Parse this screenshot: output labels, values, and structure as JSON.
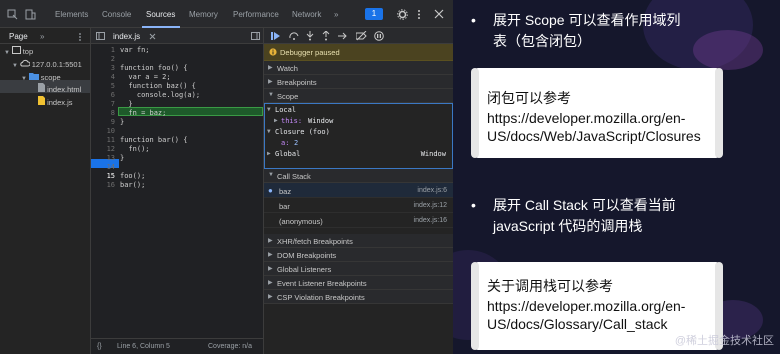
{
  "devtools": {
    "tabs": [
      "Elements",
      "Console",
      "Sources",
      "Memory",
      "Performance",
      "Network"
    ],
    "active_tab": "Sources",
    "overflow": "»",
    "badge": "1",
    "navigator": {
      "tab": "Page",
      "overflow": "»",
      "tree": [
        "top",
        "127.0.0.1:5501",
        "scope",
        "index.html",
        "index.js"
      ]
    },
    "editor": {
      "file_tab": "index.js",
      "line_numbers": [
        "1",
        "2",
        "3",
        "4",
        "5",
        "6",
        "7",
        "8",
        "9",
        "10",
        "11",
        "12",
        "13",
        "14",
        "15",
        "16"
      ],
      "lines": [
        "var fn;",
        "",
        "function foo() {",
        "  var a = 2;",
        "  function baz() {",
        "    console.log(a);",
        "  }",
        "  fn = baz;",
        "}",
        "",
        "function bar() {",
        "  fn();",
        "}",
        "",
        "foo();",
        "bar();"
      ],
      "status": "Line 6, Column 5",
      "coverage": "Coverage: n/a"
    },
    "debugger": {
      "paused": "Debugger paused",
      "sections_top": [
        "Watch",
        "Breakpoints",
        "Scope"
      ],
      "scope": {
        "local": "Local",
        "this_key": "this:",
        "this_val": "Window",
        "closure": "Closure (foo)",
        "a_key": "a:",
        "a_val": "2",
        "global": "Global",
        "global_val": "Window"
      },
      "call_stack_title": "Call Stack",
      "frames": [
        {
          "name": "baz",
          "loc": "index.js:6"
        },
        {
          "name": "bar",
          "loc": "index.js:12"
        },
        {
          "name": "(anonymous)",
          "loc": "index.js:16"
        }
      ],
      "sections_bottom": [
        "XHR/fetch Breakpoints",
        "DOM Breakpoints",
        "Global Listeners",
        "Event Listener Breakpoints",
        "CSP Violation Breakpoints"
      ]
    }
  },
  "slide": {
    "bullet1": [
      "展开 Scope 可以查看作用域列",
      "表（包含闭包）"
    ],
    "card1": [
      "闭包可以参考",
      "https://developer.mozilla.org/en-",
      "US/docs/Web/JavaScript/Closures"
    ],
    "bullet2": [
      "展开 Call Stack 可以查看当前",
      "javaScript 代码的调用栈"
    ],
    "card2": [
      "关于调用栈可以参考",
      "https://developer.mozilla.org/en-",
      "US/docs/Glossary/Call_stack"
    ],
    "watermark": "@稀土掘金技术社区"
  },
  "colors": {
    "accent": "#1a73e8",
    "paused_bg": "#4b4320",
    "highlight": "#1e5a2a",
    "slide_bg": "#15172c"
  }
}
